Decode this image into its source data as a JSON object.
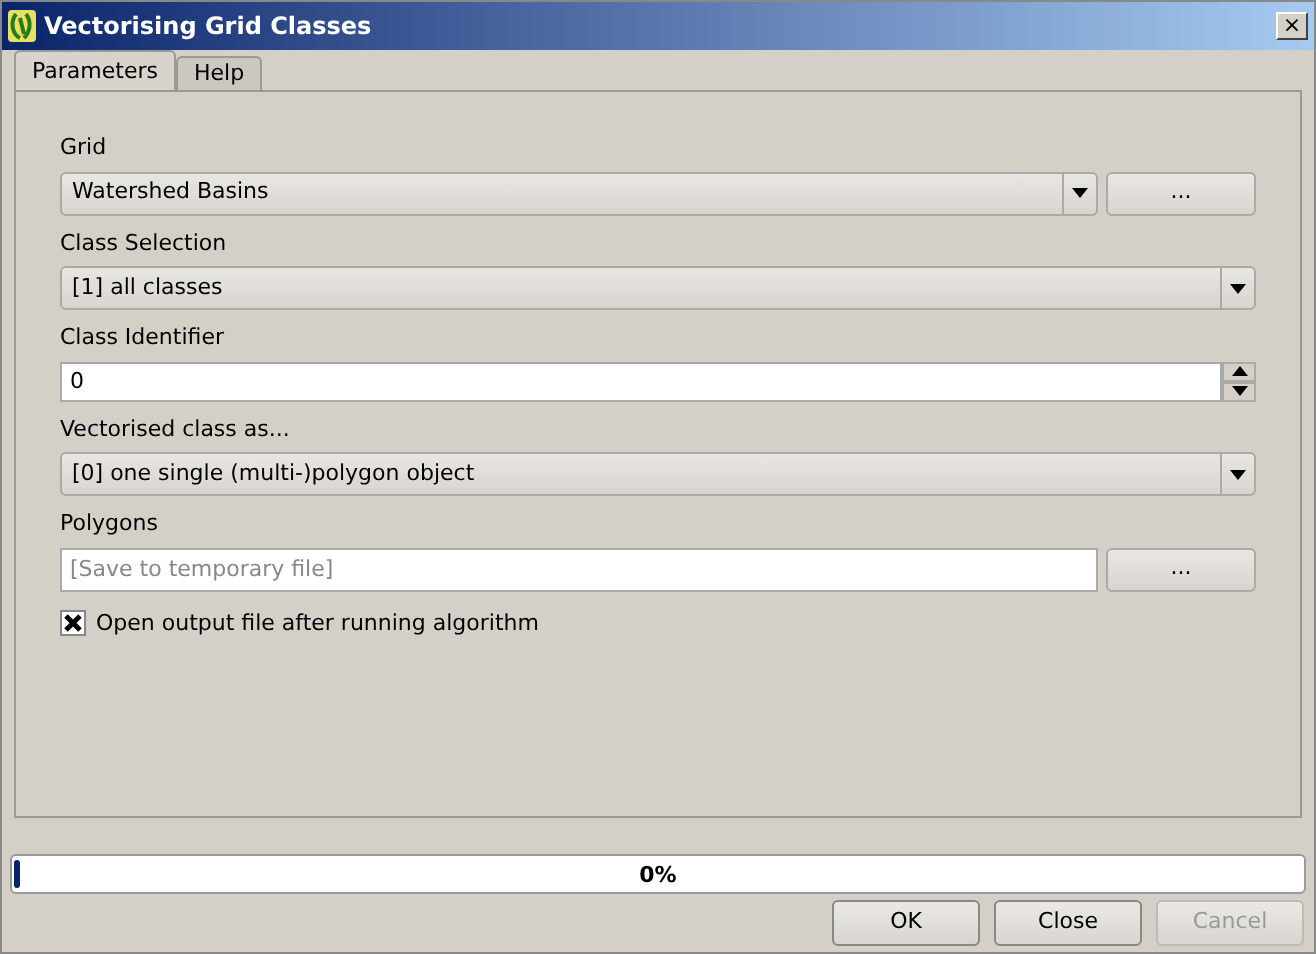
{
  "window": {
    "title": "Vectorising Grid Classes",
    "close": "×"
  },
  "tabs": [
    {
      "label": "Parameters",
      "selected": true
    },
    {
      "label": "Help",
      "selected": false
    }
  ],
  "fields": [
    {
      "kind": "combo",
      "label": "Grid",
      "value": "Watershed Basins",
      "browse": "..."
    },
    {
      "kind": "combo",
      "label": "Class Selection",
      "value": "[1] all classes"
    },
    {
      "kind": "spin",
      "label": "Class Identifier",
      "value": "0"
    },
    {
      "kind": "combo",
      "label": "Vectorised class as...",
      "value": "[0] one single (multi-)polygon object"
    },
    {
      "kind": "file",
      "label": "Polygons",
      "placeholder": "[Save to temporary file]",
      "browse": "..."
    },
    {
      "kind": "checkbox",
      "label": "Open output file after running algorithm",
      "checked": true
    }
  ],
  "progress": {
    "level": 0,
    "reading": "0%"
  },
  "buttons": [
    {
      "label": "OK",
      "disabled": false
    },
    {
      "label": "Close",
      "disabled": false
    },
    {
      "label": "Cancel",
      "disabled": true
    }
  ]
}
